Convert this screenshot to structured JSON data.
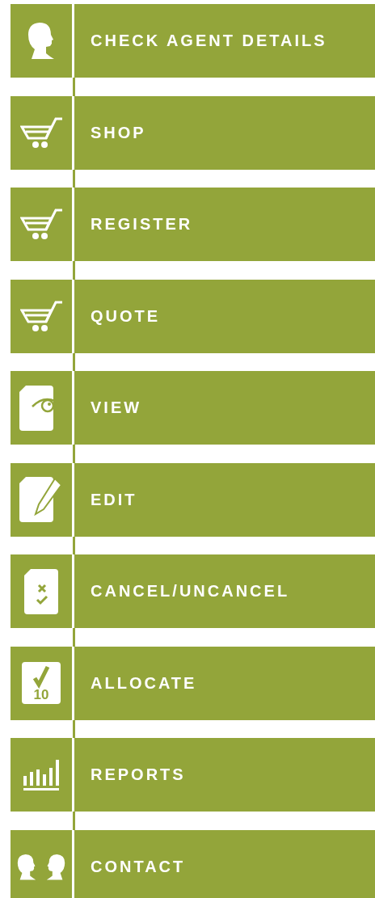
{
  "menu": [
    {
      "label": "CHECK AGENT DETAILS",
      "kind": "head"
    },
    {
      "label": "SHOP",
      "kind": "cart"
    },
    {
      "label": "REGISTER",
      "kind": "cart"
    },
    {
      "label": "QUOTE",
      "kind": "cart"
    },
    {
      "label": "VIEW",
      "kind": "eye"
    },
    {
      "label": "EDIT",
      "kind": "edit"
    },
    {
      "label": "CANCEL/UNCANCEL",
      "kind": "checklist"
    },
    {
      "label": "ALLOCATE",
      "kind": "score",
      "icon_text": "10"
    },
    {
      "label": "REPORTS",
      "kind": "bars"
    },
    {
      "label": "CONTACT",
      "kind": "heads"
    }
  ]
}
